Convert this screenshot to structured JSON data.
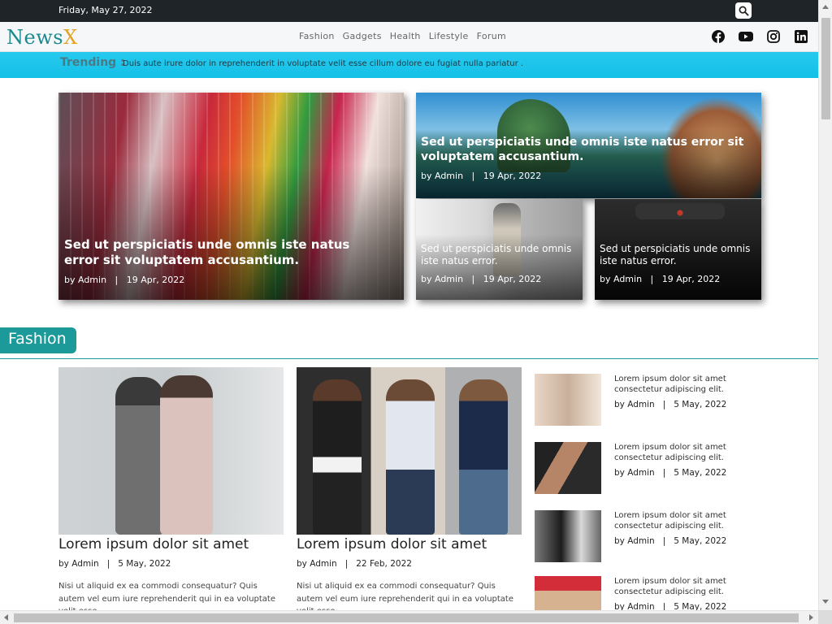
{
  "topbar": {
    "date": "Friday, May 27, 2022",
    "search_icon": "search-icon"
  },
  "brand": {
    "name_main": "News",
    "name_accent": "X",
    "color_main": "#1a8a8f",
    "color_accent": "#e2a522"
  },
  "nav": {
    "items": [
      "Fashion",
      "Gadgets",
      "Health",
      "Lifestyle",
      "Forum"
    ]
  },
  "social": [
    "facebook-icon",
    "youtube-icon",
    "instagram-icon",
    "linkedin-icon"
  ],
  "trending": {
    "label": "Trending :",
    "text": "Duis aute irure dolor in reprehenderit in voluptate velit esse cillum dolore eu fugiat nulla pariatur ."
  },
  "hero": [
    {
      "title": "Sed ut perspiciatis unde omnis iste natus error sit voluptatem accusantium.",
      "meta": "by Admin   |   19 Apr, 2022"
    },
    {
      "title": "Sed ut perspiciatis unde omnis iste natus error sit voluptatem accusantium.",
      "meta": "by Admin   |   19 Apr, 2022"
    },
    {
      "title": "Sed ut perspiciatis unde omnis iste natus error.",
      "meta": "by Admin   |   19 Apr, 2022"
    },
    {
      "title": "Sed ut perspiciatis unde omnis iste natus error.",
      "meta": "by Admin   |   19 Apr, 2022"
    }
  ],
  "section": {
    "title": "Fashion",
    "color": "#1c9a9a"
  },
  "articles": [
    {
      "headline": "Lorem ipsum dolor sit amet",
      "meta": "by Admin   |   5 May, 2022",
      "body": "Nisi ut aliquid ex ea commodi consequatur? Quis autem vel eum iure reprehenderit qui in ea voluptate velit esse"
    },
    {
      "headline": "Lorem ipsum dolor sit amet",
      "meta": "by Admin   |   22 Feb, 2022",
      "body": "Nisi ut aliquid ex ea commodi consequatur? Quis autem vel eum iure reprehenderit qui in ea voluptate velit esse"
    }
  ],
  "side_list": [
    {
      "text": "Lorem ipsum dolor sit amet consectetur adipiscing elit.",
      "meta": "by Admin   |   5 May, 2022"
    },
    {
      "text": "Lorem ipsum dolor sit amet consectetur adipiscing elit.",
      "meta": "by Admin   |   5 May, 2022"
    },
    {
      "text": "Lorem ipsum dolor sit amet consectetur adipiscing elit.",
      "meta": "by Admin   |   5 May, 2022"
    },
    {
      "text": "Lorem ipsum dolor sit amet consectetur adipiscing elit.",
      "meta": "by Admin   |   5 May, 2022"
    }
  ]
}
